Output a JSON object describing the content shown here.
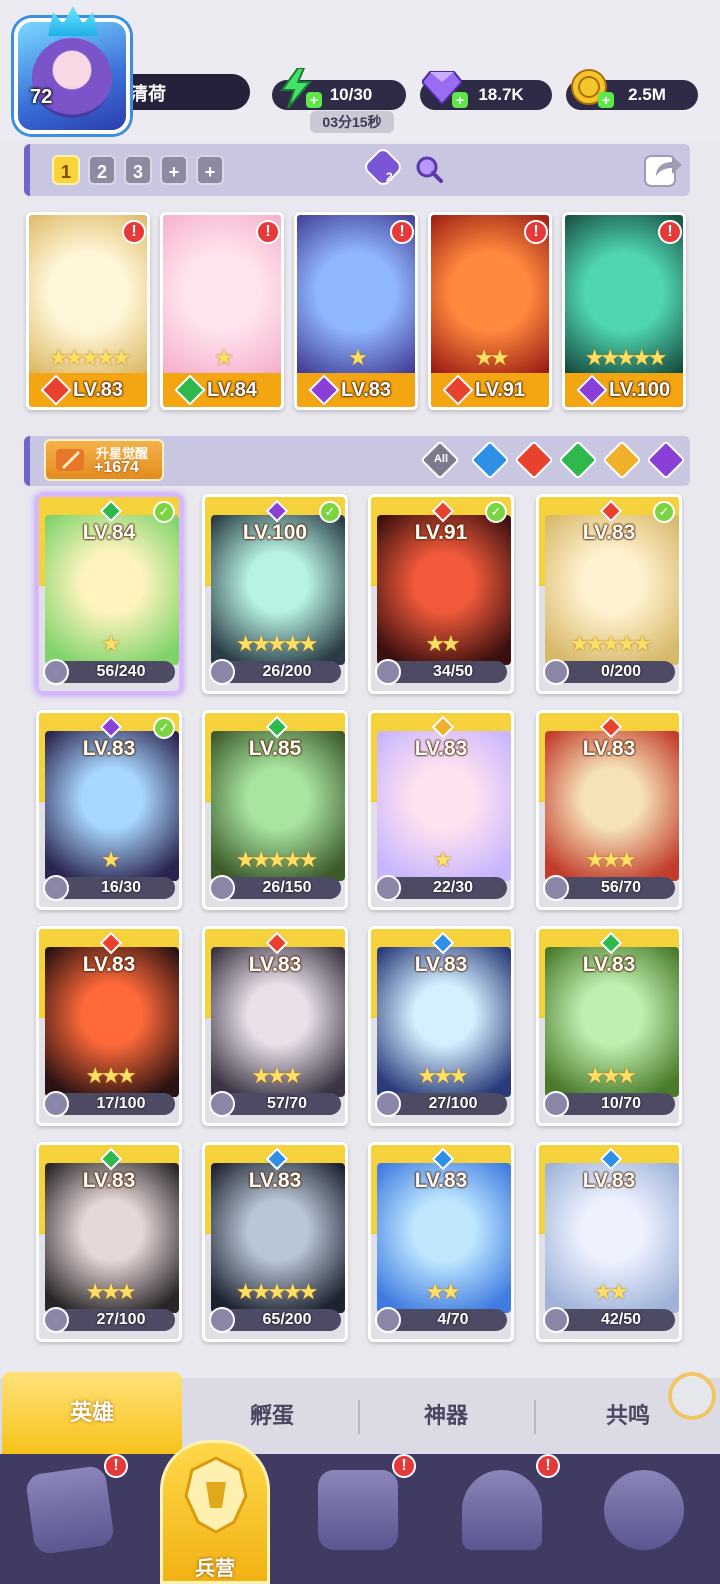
{
  "player": {
    "level": "72",
    "name": "月清荷"
  },
  "resources": {
    "energy": "10/30",
    "energy_timer": "03分15秒",
    "gems": "18.7K",
    "gold": "2.5M"
  },
  "team_tabs": [
    "1",
    "2",
    "3",
    "+",
    "+"
  ],
  "team_badge": "2",
  "team": [
    {
      "level": "LV.83",
      "stars": "★★★★★",
      "element": "fire",
      "art": [
        "#fff6d8",
        "#d9b25a"
      ]
    },
    {
      "level": "LV.84",
      "stars": "★",
      "element": "nature",
      "art": [
        "#ffe3ee",
        "#f4a9c8"
      ]
    },
    {
      "level": "LV.83",
      "stars": "★",
      "element": "dark",
      "art": [
        "#8fb7ff",
        "#3a2f8a"
      ]
    },
    {
      "level": "LV.91",
      "stars": "★★",
      "element": "fire",
      "art": [
        "#ff8a3d",
        "#8f1010"
      ]
    },
    {
      "level": "LV.100",
      "stars": "★★★★★",
      "element": "dark",
      "art": [
        "#4fd6b0",
        "#0f3b33"
      ]
    }
  ],
  "upstar": {
    "title": "升星觉醒",
    "value": "+1674"
  },
  "filter_all": "All",
  "heroes": [
    {
      "level": "LV.84",
      "element": "nature",
      "checked": true,
      "stars": "★",
      "shards": "56/240",
      "art": [
        "#fff4bf",
        "#7fd36a"
      ]
    },
    {
      "level": "LV.100",
      "element": "dark",
      "checked": true,
      "stars": "★★★★★",
      "shards": "26/200",
      "art": [
        "#b7f2e2",
        "#2a3d46"
      ]
    },
    {
      "level": "LV.91",
      "element": "fire",
      "checked": true,
      "stars": "★★",
      "shards": "34/50",
      "art": [
        "#f05a3a",
        "#3a0f0f"
      ]
    },
    {
      "level": "LV.83",
      "element": "fire",
      "checked": true,
      "stars": "★★★★★",
      "shards": "0/200",
      "art": [
        "#fff2d0",
        "#d7b96a"
      ]
    },
    {
      "level": "LV.83",
      "element": "dark",
      "checked": true,
      "stars": "★",
      "shards": "16/30",
      "art": [
        "#a9d8ff",
        "#2a2450"
      ]
    },
    {
      "level": "LV.85",
      "element": "nature",
      "checked": false,
      "stars": "★★★★★",
      "shards": "26/150",
      "art": [
        "#a8e6a0",
        "#3e5b2c"
      ]
    },
    {
      "level": "LV.83",
      "element": "light",
      "checked": false,
      "stars": "★",
      "shards": "22/30",
      "art": [
        "#ffe2ef",
        "#c7b5ff"
      ]
    },
    {
      "level": "LV.83",
      "element": "fire",
      "checked": false,
      "stars": "★★★",
      "shards": "56/70",
      "art": [
        "#f5e2b7",
        "#c23b2b"
      ]
    },
    {
      "level": "LV.83",
      "element": "fire",
      "checked": false,
      "stars": "★★★",
      "shards": "17/100",
      "art": [
        "#ff6a3a",
        "#2b1212"
      ]
    },
    {
      "level": "LV.83",
      "element": "fire",
      "checked": false,
      "stars": "★★★",
      "shards": "57/70",
      "art": [
        "#e9e0ea",
        "#3b3442"
      ]
    },
    {
      "level": "LV.83",
      "element": "water",
      "checked": false,
      "stars": "★★★",
      "shards": "27/100",
      "art": [
        "#d4f0ff",
        "#2a3a7a"
      ]
    },
    {
      "level": "LV.83",
      "element": "nature",
      "checked": false,
      "stars": "★★★",
      "shards": "10/70",
      "art": [
        "#bff0b0",
        "#4a7a2a"
      ]
    },
    {
      "level": "LV.83",
      "element": "nature",
      "checked": false,
      "stars": "★★★",
      "shards": "27/100",
      "art": [
        "#e7d8d8",
        "#2a2628"
      ]
    },
    {
      "level": "LV.83",
      "element": "water",
      "checked": false,
      "stars": "★★★★★",
      "shards": "65/200",
      "art": [
        "#b8c6d6",
        "#1c2230"
      ]
    },
    {
      "level": "LV.83",
      "element": "water",
      "checked": false,
      "stars": "★★",
      "shards": "4/70",
      "art": [
        "#bfe8ff",
        "#3f7be0"
      ]
    },
    {
      "level": "LV.83",
      "element": "water",
      "checked": false,
      "stars": "★★",
      "shards": "42/50",
      "art": [
        "#eef2ff",
        "#9fb3d8"
      ]
    }
  ],
  "subtabs": [
    "英雄",
    "孵蛋",
    "神器",
    "共鸣"
  ],
  "nav_active_label": "兵营",
  "colors": {
    "fire": "#e8412e",
    "nature": "#2fb84c",
    "dark": "#8a3fd6",
    "water": "#2d8fe6",
    "light": "#f0b12a"
  }
}
